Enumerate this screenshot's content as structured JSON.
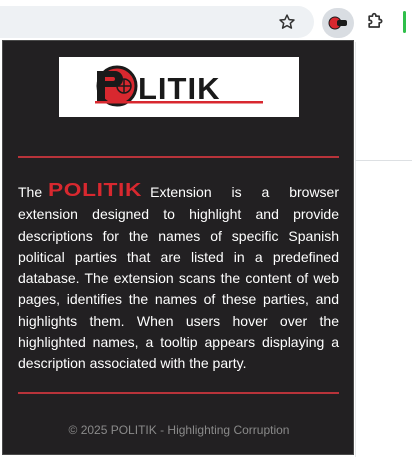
{
  "brand": {
    "logo_text": "POLITIK",
    "colors": {
      "accent": "#b8333a",
      "logo_red": "#d8282f",
      "popup_bg": "#222022",
      "logo_dark": "#1a1a1a"
    }
  },
  "toolbar": {
    "icons": [
      "star-icon",
      "extension-logo-icon",
      "puzzle-icon"
    ]
  },
  "popup": {
    "intro_word": "The",
    "description": "Extension is a browser extension designed to highlight and provide descriptions for the names of specific Spanish political parties that are listed in a predefined database. The extension scans the content of web pages, identifies the names of these parties, and highlights them. When users hover over the highlighted names, a tooltip appears displaying a description associated with the party.",
    "footer": "© 2025 POLITIK - Highlighting Corruption"
  }
}
